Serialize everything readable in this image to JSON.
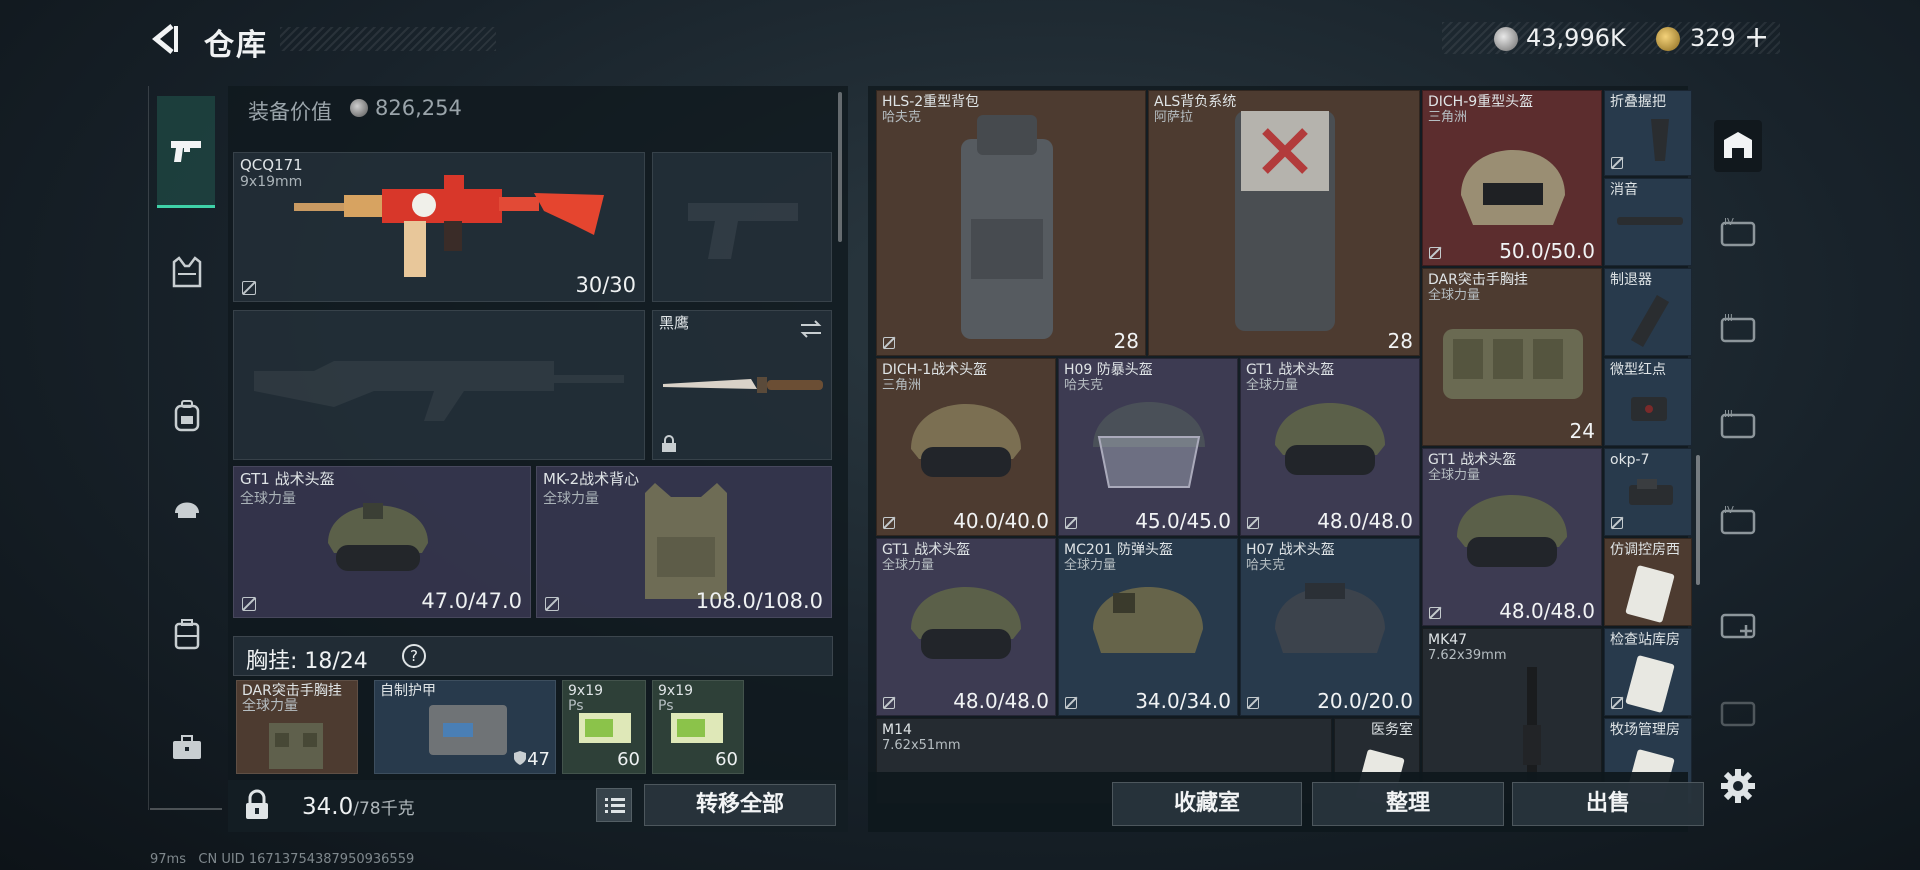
{
  "header": {
    "title": "仓库",
    "money": "43,996K",
    "gold": "329",
    "plus_label": "+"
  },
  "equipment": {
    "value_label": "装备价值",
    "value": "826,254",
    "primary_weapon": {
      "name": "QCQ171",
      "caliber": "9x19mm",
      "ammo": "30/30"
    },
    "melee": {
      "name": "黑鹰"
    },
    "helmet": {
      "name": "GT1 战术头盔",
      "maker": "全球力量",
      "durability": "47.0/47.0"
    },
    "armor": {
      "name": "MK-2战术背心",
      "maker": "全球力量",
      "durability": "108.0/108.0"
    },
    "chest_rig_label": "胸挂: 18/24",
    "chest_help": "?",
    "rig_items": [
      {
        "name": "DAR突击手胸挂",
        "maker": "全球力量",
        "value": ""
      },
      {
        "name": "自制护甲",
        "maker": "",
        "value": "47"
      },
      {
        "name": "9x19",
        "maker": "Ps",
        "value": "60"
      },
      {
        "name": "9x19",
        "maker": "Ps",
        "value": "60"
      }
    ],
    "weight": "34.0",
    "weight_max": "/78千克",
    "transfer_all": "转移全部"
  },
  "stash": {
    "items": [
      {
        "name": "HLS-2重型背包",
        "maker": "哈夫克",
        "value": "28"
      },
      {
        "name": "ALS背负系统",
        "maker": "阿萨拉",
        "value": "28"
      },
      {
        "name": "DICH-9重型头盔",
        "maker": "三角洲",
        "value": "50.0/50.0"
      },
      {
        "name": "折叠握把",
        "maker": "",
        "value": ""
      },
      {
        "name": "消音",
        "maker": "",
        "value": ""
      },
      {
        "name": "DAR突击手胸挂",
        "maker": "全球力量",
        "value": "24"
      },
      {
        "name": "制退器",
        "maker": "",
        "value": ""
      },
      {
        "name": "DICH-1战术头盔",
        "maker": "三角洲",
        "value": "40.0/40.0"
      },
      {
        "name": "H09 防暴头盔",
        "maker": "哈夫克",
        "value": "45.0/45.0"
      },
      {
        "name": "GT1 战术头盔",
        "maker": "全球力量",
        "value": "48.0/48.0"
      },
      {
        "name": "微型红点",
        "maker": "",
        "value": ""
      },
      {
        "name": "GT1 战术头盔",
        "maker": "全球力量",
        "value": "48.0/48.0"
      },
      {
        "name": "okp-7",
        "maker": "",
        "value": ""
      },
      {
        "name": "GT1 战术头盔",
        "maker": "全球力量",
        "value": "48.0/48.0"
      },
      {
        "name": "MC201 防弹头盔",
        "maker": "全球力量",
        "value": "34.0/34.0"
      },
      {
        "name": "H07 战术头盔",
        "maker": "哈夫克",
        "value": "20.0/20.0"
      },
      {
        "name": "仿调控房西",
        "maker": "",
        "value": ""
      },
      {
        "name": "MK47",
        "maker": "7.62x39mm",
        "value": ""
      },
      {
        "name": "检查站库房",
        "maker": "",
        "value": ""
      },
      {
        "name": "M14",
        "maker": "7.62x51mm",
        "value": ""
      },
      {
        "name": "医务室",
        "maker": "",
        "value": ""
      },
      {
        "name": "牧场管理房",
        "maker": "",
        "value": ""
      }
    ],
    "buttons": {
      "collection": "收藏室",
      "sort": "整理",
      "sell": "出售"
    }
  },
  "footer": {
    "ping": "97ms",
    "uid": "CN UID 16713754387950936559"
  },
  "colors": {
    "accent": "#3fd1a8",
    "rarity_brown": "#4d3b30",
    "rarity_purple": "#3d3b52",
    "rarity_blue": "#283a4c",
    "rarity_red": "#5c2d2e"
  },
  "icons": [
    "back-arrow-icon",
    "pistol-icon",
    "vest-icon",
    "backpack-icon",
    "helmet-icon",
    "case-icon",
    "briefcase-icon",
    "lock-icon",
    "list-icon",
    "stash-icon",
    "key-case-icon",
    "settings-gear-icon"
  ]
}
